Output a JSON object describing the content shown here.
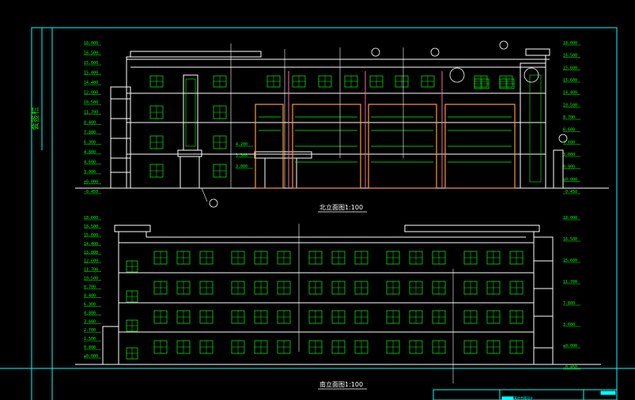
{
  "colors": {
    "background": "#000000",
    "frame": "#00ffff",
    "building": "#ffffff",
    "window": "#00ff00",
    "level": "#00ff00",
    "orange": "#ff9933",
    "pink": "#ff6699",
    "annotation": "#00ff00",
    "title_block": "#00ffff"
  },
  "sidebar": {
    "label": "会签栏"
  },
  "north_elevation": {
    "title": "北立面图1:100",
    "levels_left": [
      "18.000",
      "16.500",
      "15.600",
      "15.400",
      "14.400",
      "12.000",
      "10.500",
      "11.700",
      "8.400",
      "7.800",
      "6.300",
      "4.800",
      "4.600",
      "3.000",
      "±0.000",
      "-0.450"
    ],
    "levels_right": [
      "18.000",
      "16.500",
      "15.600",
      "15.600",
      "14.400",
      "10.500",
      "8.700",
      "6.600",
      "4.600",
      "3.000",
      "0.900",
      "±0.000",
      "-0.450"
    ],
    "center_levels": [
      "4.200",
      "3.300",
      "3.000"
    ]
  },
  "south_elevation": {
    "title": "南立面图1:100",
    "levels_left": [
      "18.000",
      "16.500",
      "15.600",
      "14.400",
      "13.800",
      "12.600",
      "11.700",
      "10.500",
      "8.700",
      "8.400",
      "6.300",
      "4.800",
      "3.600",
      "2.700",
      "1.500",
      "0.800",
      "±0.000"
    ],
    "levels_right": [
      "18.000",
      "16.500",
      "15.600",
      "11.700",
      "7.800",
      "3.600",
      "±0.000",
      "-0.450"
    ]
  },
  "title_block": {
    "label": "某综合楼设计"
  }
}
